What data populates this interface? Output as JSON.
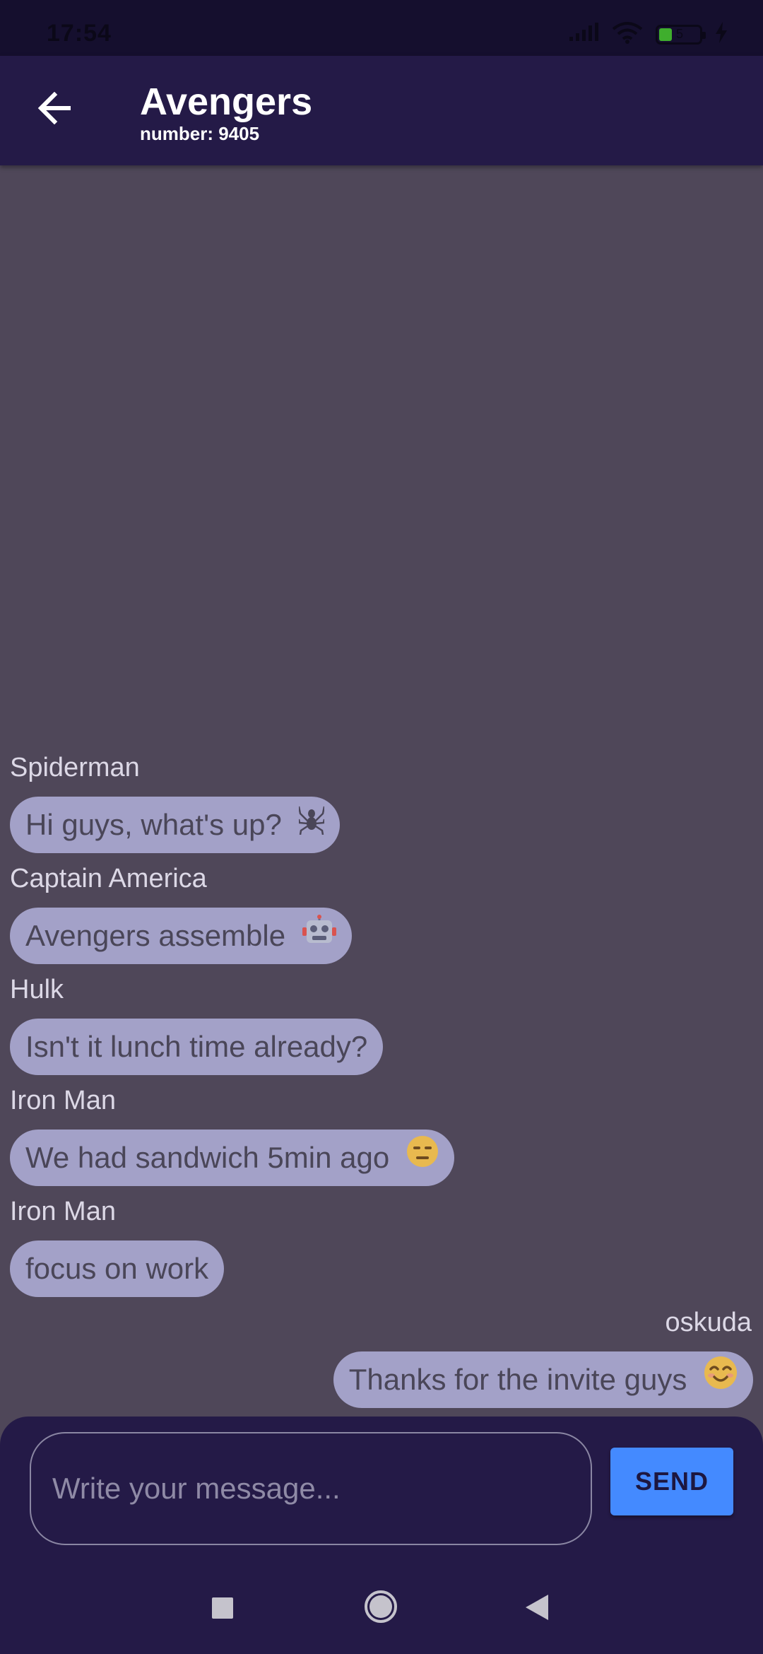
{
  "status_bar": {
    "time": "17:54",
    "battery_level": "5",
    "signal_icon": "signal-icon",
    "wifi_icon": "wifi-icon",
    "battery_icon": "battery-icon",
    "charging_icon": "charging-icon"
  },
  "header": {
    "title": "Avengers",
    "subtitle": "number: 9405",
    "back_icon": "arrow-back-icon"
  },
  "messages": [
    {
      "sender": "Spiderman",
      "text": "Hi guys, what's up?",
      "emoji_icon": "spider-icon",
      "outgoing": false
    },
    {
      "sender": "Captain America",
      "text": "Avengers assemble",
      "emoji_icon": "robot-icon",
      "outgoing": false
    },
    {
      "sender": "Hulk",
      "text": "Isn't it lunch time already?",
      "emoji_icon": "",
      "outgoing": false
    },
    {
      "sender": "Iron Man",
      "text": "We had sandwich 5min ago",
      "emoji_icon": "expressionless-face-icon",
      "outgoing": false
    },
    {
      "sender": "Iron Man",
      "text": "focus on work",
      "emoji_icon": "",
      "outgoing": false
    },
    {
      "sender": "oskuda",
      "text": "Thanks for the invite guys",
      "emoji_icon": "smiling-face-icon",
      "outgoing": true
    }
  ],
  "composer": {
    "placeholder": "Write your message...",
    "send_label": "SEND"
  },
  "nav_bar": {
    "recents_icon": "recents-square-icon",
    "home_icon": "home-circle-icon",
    "back_icon": "back-triangle-icon"
  },
  "colors": {
    "status_bar_bg": "#150f2e",
    "app_bar_bg": "#241a47",
    "chat_bg": "#4f4759",
    "bubble_bg": "#a3a1c8",
    "send_button_bg": "#448aff"
  }
}
